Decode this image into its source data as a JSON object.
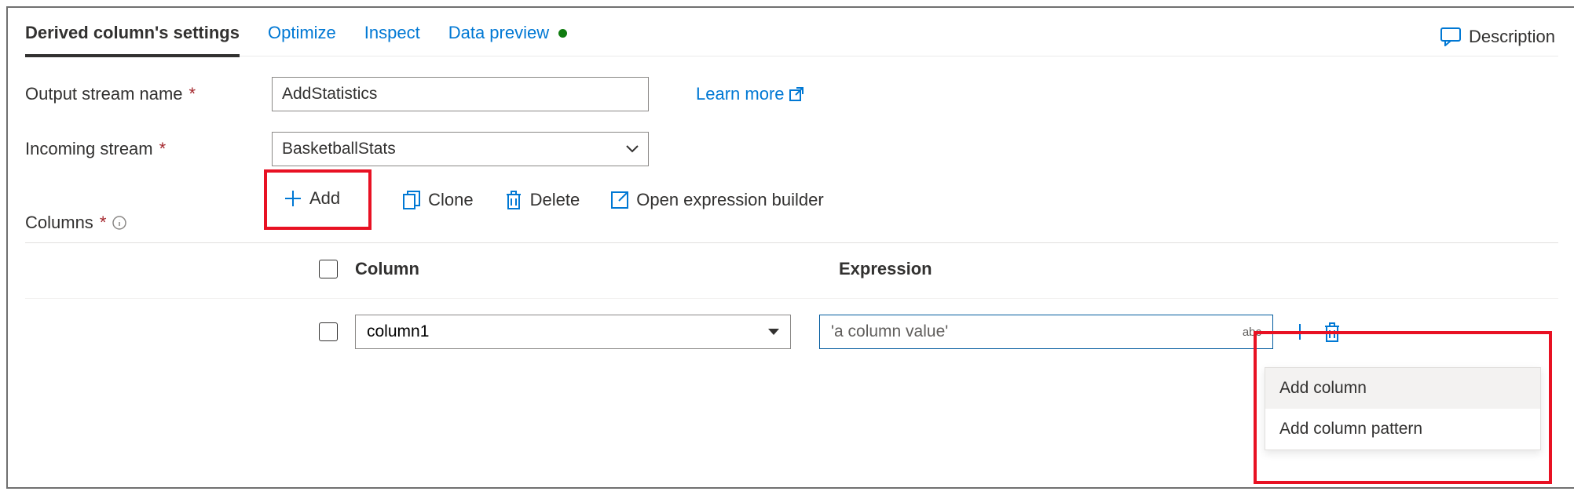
{
  "tabs": {
    "settings": "Derived column's settings",
    "optimize": "Optimize",
    "inspect": "Inspect",
    "preview": "Data preview"
  },
  "description_label": "Description",
  "fields": {
    "output_label": "Output stream name",
    "output_value": "AddStatistics",
    "incoming_label": "Incoming stream",
    "incoming_value": "BasketballStats",
    "columns_label": "Columns"
  },
  "learn_more": "Learn more",
  "toolbar": {
    "add": "Add",
    "clone": "Clone",
    "delete": "Delete",
    "open_builder": "Open expression builder"
  },
  "table": {
    "col_header": "Column",
    "expr_header": "Expression",
    "row1": {
      "column": "column1",
      "expression_placeholder": "'a column value'",
      "type_badge": "abc"
    }
  },
  "context_menu": {
    "add_col": "Add column",
    "add_pattern": "Add column pattern"
  }
}
